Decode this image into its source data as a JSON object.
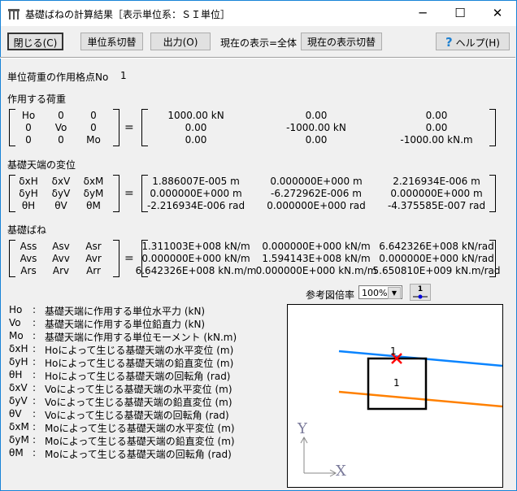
{
  "window": {
    "title": "基礎ばねの計算結果［表示単位系：ＳＩ単位］",
    "minimize": "─",
    "maximize": "☐",
    "close": "✕"
  },
  "toolbar": {
    "close_label": "閉じる(C)",
    "unit_toggle_label": "単位系切替",
    "output_label": "出力(O)",
    "current_display_text": "現在の表示=全体",
    "display_toggle_label": "現在の表示切替",
    "help_label": "ヘルプ(H)",
    "help_icon": "?"
  },
  "node": {
    "label": "単位荷重の作用格点No",
    "value": "1"
  },
  "sections": [
    {
      "title": "作用する荷重",
      "names": [
        [
          "Ho",
          "0",
          "0"
        ],
        [
          "0",
          "Vo",
          "0"
        ],
        [
          "0",
          "0",
          "Mo"
        ]
      ],
      "values": [
        [
          "1000.00 kN",
          "0.00",
          "0.00"
        ],
        [
          "0.00",
          "-1000.00 kN",
          "0.00"
        ],
        [
          "0.00",
          "0.00",
          "-1000.00 kN.m"
        ]
      ]
    },
    {
      "title": "基礎天端の変位",
      "names": [
        [
          "δxH",
          "δxV",
          "δxM"
        ],
        [
          "δyH",
          "δyV",
          "δyM"
        ],
        [
          "θH",
          "θV",
          "θM"
        ]
      ],
      "values": [
        [
          "1.886007E-005 m",
          "0.000000E+000 m",
          "2.216934E-006 m"
        ],
        [
          "0.000000E+000 m",
          "-6.272962E-006 m",
          "0.000000E+000 m"
        ],
        [
          "-2.216934E-006 rad",
          "0.000000E+000 rad",
          "-4.375585E-007 rad"
        ]
      ]
    },
    {
      "title": "基礎ばね",
      "names": [
        [
          "Ass",
          "Asv",
          "Asr"
        ],
        [
          "Avs",
          "Avv",
          "Avr"
        ],
        [
          "Ars",
          "Arv",
          "Arr"
        ]
      ],
      "values": [
        [
          "1.311003E+008 kN/m",
          "0.000000E+000 kN/m",
          "6.642326E+008 kN/rad"
        ],
        [
          "0.000000E+000 kN/m",
          "1.594143E+008 kN/m",
          "0.000000E+000 kN/rad"
        ],
        [
          "6.642326E+008 kN.m/m",
          "0.000000E+000 kN.m/m",
          "5.650810E+009 kN.m/rad"
        ]
      ]
    }
  ],
  "equals": "=",
  "legend": [
    {
      "key": "Ho",
      "text": "基礎天端に作用する単位水平力 (kN)"
    },
    {
      "key": "Vo",
      "text": "基礎天端に作用する単位鉛直力 (kN)"
    },
    {
      "key": "Mo",
      "text": "基礎天端に作用する単位モーメント (kN.m)"
    },
    {
      "key": "δxH",
      "text": "Hoによって生じる基礎天端の水平変位 (m)"
    },
    {
      "key": "δyH",
      "text": "Hoによって生じる基礎天端の鉛直変位 (m)"
    },
    {
      "key": "θH",
      "text": "Hoによって生じる基礎天端の回転角 (rad)"
    },
    {
      "key": "δxV",
      "text": "Voによって生じる基礎天端の水平変位 (m)"
    },
    {
      "key": "δyV",
      "text": "Voによって生じる基礎天端の鉛直変位 (m)"
    },
    {
      "key": "θV",
      "text": "Voによって生じる基礎天端の回転角 (rad)"
    },
    {
      "key": "δxM",
      "text": "Moによって生じる基礎天端の水平変位 (m)"
    },
    {
      "key": "δyM",
      "text": "Moによって生じる基礎天端の鉛直変位 (m)"
    },
    {
      "key": "θM",
      "text": "Moによって生じる基礎天端の回転角 (rad)"
    }
  ],
  "colon": ":",
  "figure": {
    "scale_label": "参考図倍率",
    "scale_value": "100%",
    "node_button_label": "1",
    "node_label": "1",
    "element_label": "1",
    "x_axis": "X",
    "y_axis": "Y",
    "colors": {
      "upper_line": "#0a84ff",
      "lower_line": "#ff8000",
      "marker": "#ff0000"
    }
  }
}
